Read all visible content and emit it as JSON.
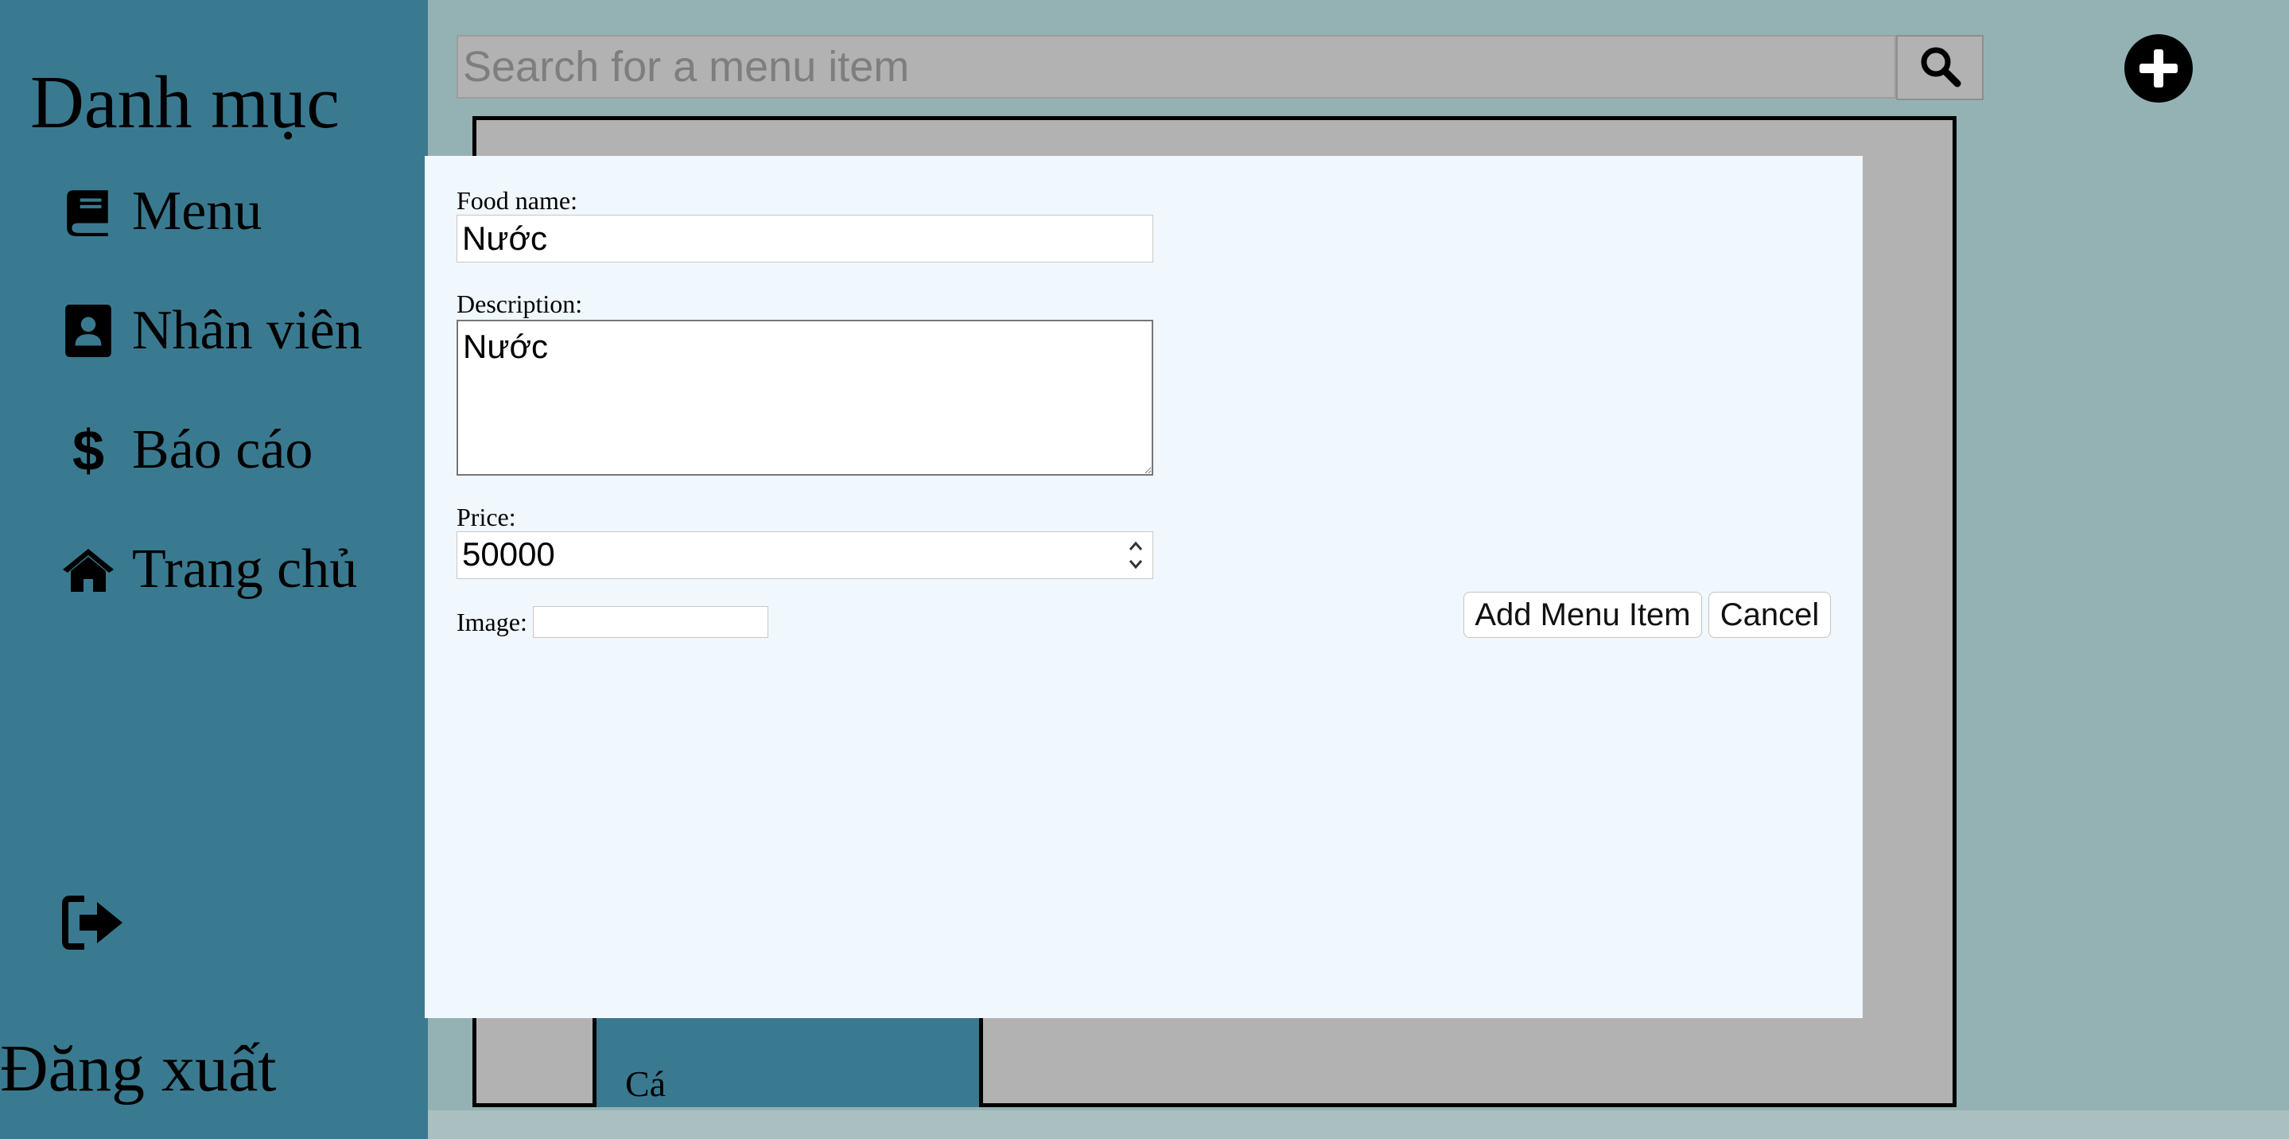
{
  "sidebar": {
    "title": "Danh mục",
    "items": [
      {
        "label": "Menu",
        "icon": "book-icon"
      },
      {
        "label": "Nhân viên",
        "icon": "contact-book-icon"
      },
      {
        "label": "Báo cáo",
        "icon": "dollar-icon"
      },
      {
        "label": "Trang chủ",
        "icon": "home-icon"
      }
    ],
    "logout_label": "Đăng xuất",
    "logout_icon": "sign-out-icon",
    "bg_color": "#3a7a90"
  },
  "header": {
    "search_placeholder": "Search for a menu item",
    "search_icon": "search-icon",
    "add_icon": "plus-circle-icon"
  },
  "background": {
    "food_card_name": "Cá"
  },
  "modal": {
    "food_name_label": "Food name:",
    "food_name_value": "Nước",
    "description_label": "Description:",
    "description_value": "Nước",
    "price_label": "Price:",
    "price_value": "50000",
    "image_label": "Image:",
    "add_button": "Add Menu Item",
    "cancel_button": "Cancel",
    "bg_color": "#f0f7fd"
  }
}
